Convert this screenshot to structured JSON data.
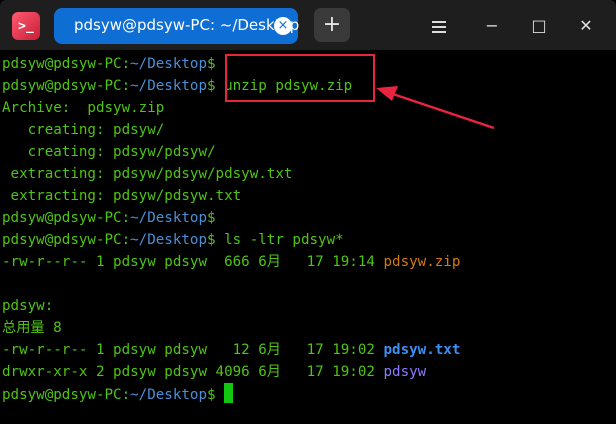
{
  "window": {
    "app_icon": ">_",
    "tab_title": "pdsyw@pdsyw-PC: ~/Desktop",
    "tab_close": "×",
    "add_tab": "+",
    "menu_icon": "menu-icon",
    "minimize": "−",
    "maximize": "□",
    "close": "✕"
  },
  "terminal": {
    "prompt_user": "pdsyw@pdsyw-PC",
    "prompt_sep": ":",
    "prompt_path": "~/Desktop",
    "prompt_end": "$",
    "cmd1": " unzip pdsyw.zip",
    "out1": "Archive:  pdsyw.zip",
    "out2": "   creating: pdsyw/",
    "out3": "   creating: pdsyw/pdsyw/",
    "out4": " extracting: pdsyw/pdsyw/pdsyw.txt",
    "out5": " extracting: pdsyw/pdsyw.txt",
    "cmd2": " ls -ltr pdsyw*",
    "ls1_meta": "-rw-r--r-- 1 pdsyw pdsyw  666 6月   17 19:14 ",
    "ls1_name": "pdsyw.zip",
    "dir_header": "pdsyw:",
    "total": "总用量 8",
    "ls2_meta": "-rw-r--r-- 1 pdsyw pdsyw   12 6月   17 19:02 ",
    "ls2_name": "pdsyw.txt",
    "ls3_meta": "drwxr-xr-x 2 pdsyw pdsyw 4096 6月   17 19:02 ",
    "ls3_name": "pdsyw"
  },
  "colors": {
    "prompt_green": "#4fc414",
    "path_blue": "#4b8fd6",
    "annotation_red": "#e8243f",
    "tab_blue": "#0f6ed4"
  }
}
